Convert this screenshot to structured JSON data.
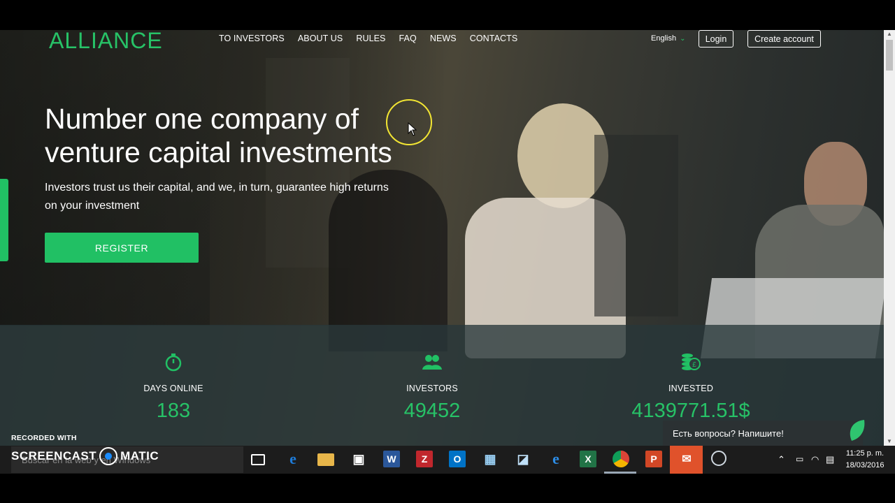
{
  "site": {
    "logo": "ALLIANCE",
    "nav": [
      "TO INVESTORS",
      "ABOUT US",
      "RULES",
      "FAQ",
      "NEWS",
      "CONTACTS"
    ],
    "language": "English",
    "login_label": "Login",
    "create_account_label": "Create account",
    "hero": {
      "title_line1": "Number one company of",
      "title_line2": "venture capital investments",
      "subtitle": "Investors trust us their capital, and we, in turn, guarantee high returns on your investment",
      "register_label": "REGISTER"
    },
    "stats": [
      {
        "label": "DAYS ONLINE",
        "value": "183",
        "icon": "stopwatch-icon"
      },
      {
        "label": "INVESTORS",
        "value": "49452",
        "icon": "people-icon"
      },
      {
        "label": "INVESTED",
        "value": "4139771.51$",
        "icon": "coins-icon"
      }
    ],
    "chat_text": "Есть вопросы? Напишите!"
  },
  "recorder": {
    "recorded_with": "RECORDED WITH",
    "brand_left": "SCREENCAST",
    "brand_right": "MATIC"
  },
  "taskbar": {
    "search_placeholder": "Buscar en la web y en Windows",
    "time": "11:25 p. m.",
    "date": "18/03/2016"
  },
  "colors": {
    "accent": "#21c064",
    "taskbar": "#1c1c1c"
  }
}
